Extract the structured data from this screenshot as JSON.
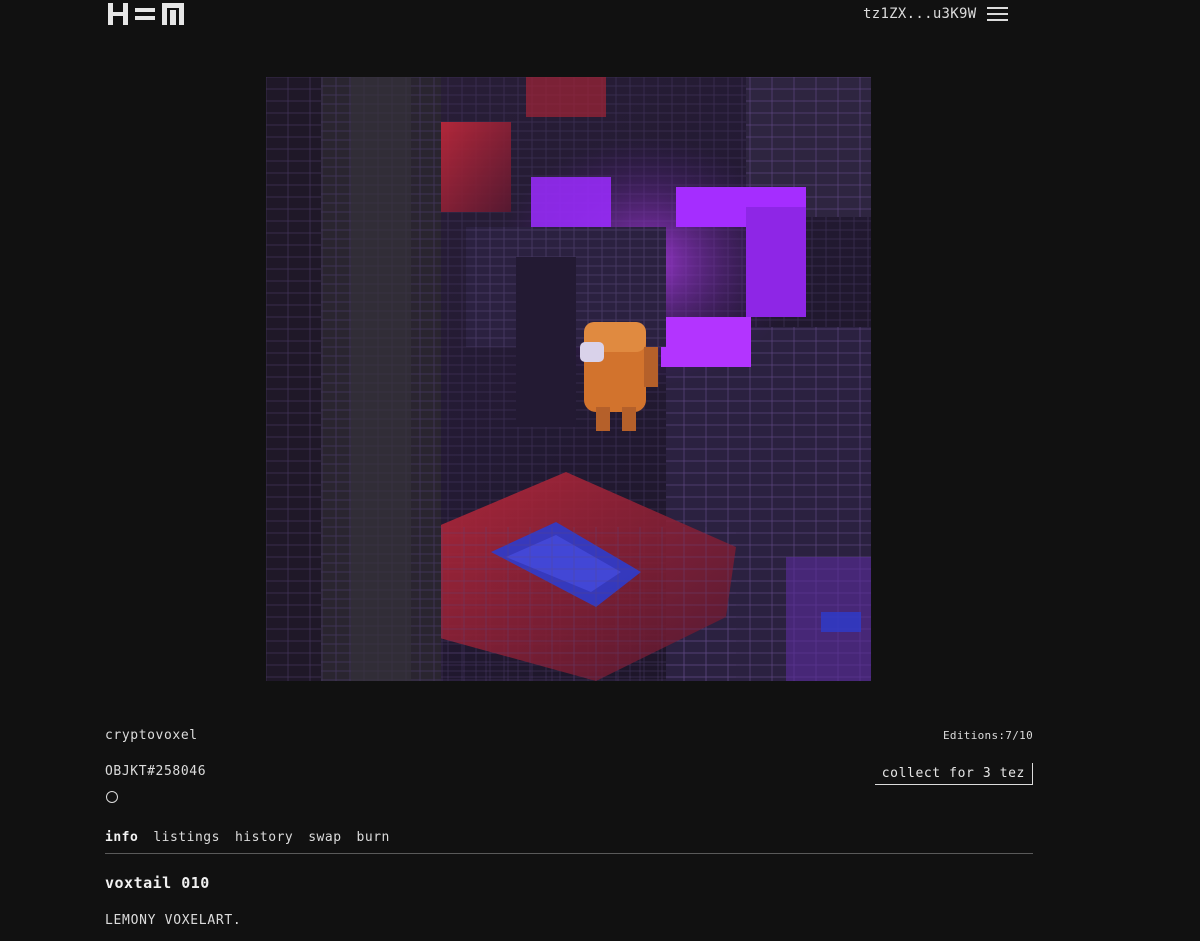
{
  "header": {
    "wallet_address": "tz1ZX...u3K9W",
    "logo_icon": "hen-logo",
    "menu_icon": "hamburger-menu-icon"
  },
  "artwork": {
    "palette": {
      "background": "#1d1626",
      "purple_glow": "#a52dff",
      "red_surface": "#8c1e2c",
      "blue_pool": "#2d3ccc",
      "orange_figure": "#d2732d"
    }
  },
  "objkt": {
    "creator": "cryptovoxel",
    "editions": "Editions:7/10",
    "id": "OBJKT#258046",
    "collect_label": "collect for 3 tez"
  },
  "tabs": [
    {
      "label": "info",
      "active": true
    },
    {
      "label": "listings",
      "active": false
    },
    {
      "label": "history",
      "active": false
    },
    {
      "label": "swap",
      "active": false
    },
    {
      "label": "burn",
      "active": false
    }
  ],
  "info": {
    "title": "voxtail 010",
    "description": "LEMONY VOXELART."
  }
}
